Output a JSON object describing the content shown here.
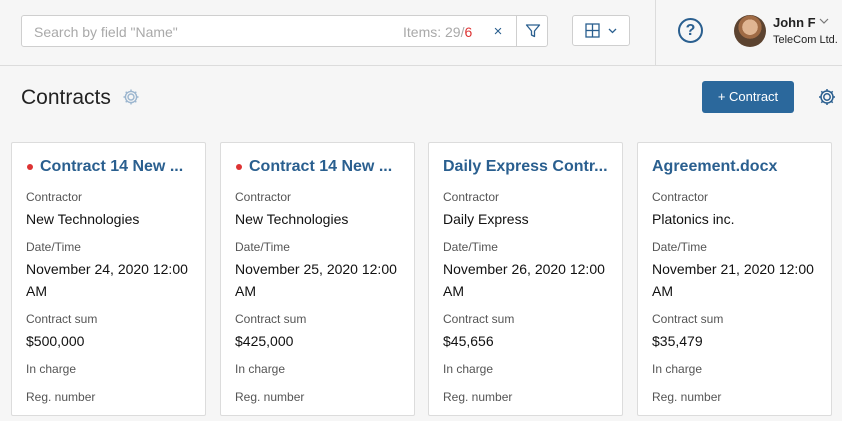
{
  "search": {
    "placeholder": "Search by field \"Name\"",
    "items_label": "Items: 29",
    "items_separator": "/",
    "items_new": "6",
    "clear": "×"
  },
  "user": {
    "name": "John F",
    "company": "TeleCom Ltd."
  },
  "help": {
    "label": "?"
  },
  "page": {
    "title": "Contracts",
    "add_button": "+ Contract"
  },
  "cards": [
    {
      "title": "Contract 14 New ...",
      "unread": true,
      "contractor_label": "Contractor",
      "contractor": "New Technologies",
      "date_label": "Date/Time",
      "date": "November 24, 2020 12:00 AM",
      "sum_label": "Contract sum",
      "sum": "$500,000",
      "charge_label": "In charge",
      "reg_label": "Reg. number"
    },
    {
      "title": "Contract 14 New ...",
      "unread": true,
      "contractor_label": "Contractor",
      "contractor": "New Technologies",
      "date_label": "Date/Time",
      "date": "November 25, 2020 12:00 AM",
      "sum_label": "Contract sum",
      "sum": "$425,000",
      "charge_label": "In charge",
      "reg_label": "Reg. number"
    },
    {
      "title": "Daily Express Contr...",
      "unread": false,
      "contractor_label": "Contractor",
      "contractor": "Daily Express",
      "date_label": "Date/Time",
      "date": "November 26, 2020 12:00 AM",
      "sum_label": "Contract sum",
      "sum": "$45,656",
      "charge_label": "In charge",
      "reg_label": "Reg. number"
    },
    {
      "title": "Agreement.docx",
      "unread": false,
      "contractor_label": "Contractor",
      "contractor": "Platonics inc.",
      "date_label": "Date/Time",
      "date": "November 21, 2020 12:00 AM",
      "sum_label": "Contract sum",
      "sum": "$35,479",
      "charge_label": "In charge",
      "reg_label": "Reg. number"
    }
  ],
  "colors": {
    "accent": "#2b689c",
    "link": "#2a5f8f",
    "unread_dot": "#dd3333"
  },
  "icons": [
    "filter-icon",
    "grid-view-icon",
    "chevron-down-icon",
    "help-icon",
    "gear-icon"
  ]
}
